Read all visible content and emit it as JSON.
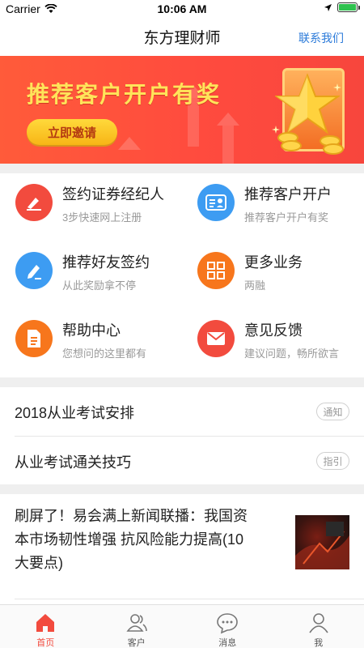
{
  "status_bar": {
    "carrier": "Carrier",
    "time": "10:06 AM"
  },
  "nav": {
    "title": "东方理财师",
    "contact": "联系我们"
  },
  "banner": {
    "headline": "推荐客户开户有奖",
    "button": "立即邀请"
  },
  "grid": [
    {
      "title": "签约证券经纪人",
      "subtitle": "3步快速网上注册",
      "icon": "pen-signature-icon",
      "color": "#f24b3e"
    },
    {
      "title": "推荐客户开户",
      "subtitle": "推荐客户开户有奖",
      "icon": "id-card-icon",
      "color": "#3d9cf2"
    },
    {
      "title": "推荐好友签约",
      "subtitle": "从此奖励拿不停",
      "icon": "pen-edit-icon",
      "color": "#3d9cf2"
    },
    {
      "title": "更多业务",
      "subtitle": "两融",
      "icon": "grid-apps-icon",
      "color": "#f7761c"
    },
    {
      "title": "帮助中心",
      "subtitle": "您想问的这里都有",
      "icon": "document-icon",
      "color": "#f7761c"
    },
    {
      "title": "意见反馈",
      "subtitle": "建议问题，畅所欲言",
      "icon": "envelope-icon",
      "color": "#f24b3e"
    }
  ],
  "list": [
    {
      "label": "2018从业考试安排",
      "tag": "通知"
    },
    {
      "label": "从业考试通关技巧",
      "tag": "指引"
    }
  ],
  "news": {
    "headline": "刷屏了！易会满上新闻联播：我国资本市场韧性增强 抗风险能力提高(10大要点)"
  },
  "tabs": [
    {
      "label": "首页",
      "icon": "home-icon",
      "active": true
    },
    {
      "label": "客户",
      "icon": "users-icon",
      "active": false
    },
    {
      "label": "消息",
      "icon": "chat-icon",
      "active": false
    },
    {
      "label": "我",
      "icon": "person-icon",
      "active": false
    }
  ],
  "colors": {
    "accent": "#f24b3e",
    "link": "#2b7ad9",
    "banner_text": "#ffe45a"
  }
}
